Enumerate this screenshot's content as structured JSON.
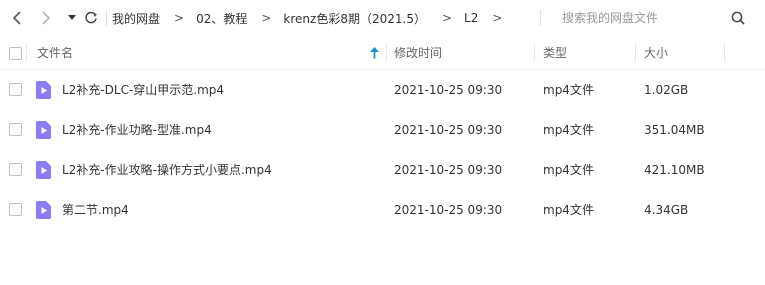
{
  "toolbar": {
    "back_icon": "back-arrow-icon",
    "forward_icon": "forward-arrow-icon",
    "history_icon": "dropdown-triangle-icon",
    "refresh_icon": "refresh-icon"
  },
  "breadcrumb": [
    {
      "label": "我的网盘"
    },
    {
      "label": "02、教程"
    },
    {
      "label": "krenz色彩8期（2021.5）"
    },
    {
      "label": "L2"
    }
  ],
  "breadcrumb_separator": ">",
  "search": {
    "placeholder": "搜索我的网盘文件",
    "value": ""
  },
  "table": {
    "headers": {
      "name": "文件名",
      "modified": "修改时间",
      "type": "类型",
      "size": "大小"
    },
    "sort": {
      "column": "name",
      "direction": "ascending"
    },
    "rows": [
      {
        "name": "L2补充-DLC-穿山甲示范.mp4",
        "modified": "2021-10-25 09:30",
        "type": "mp4文件",
        "size": "1.02GB"
      },
      {
        "name": "L2补充-作业功略-型准.mp4",
        "modified": "2021-10-25 09:30",
        "type": "mp4文件",
        "size": "351.04MB"
      },
      {
        "name": "L2补充-作业攻略-操作方式小要点.mp4",
        "modified": "2021-10-25 09:30",
        "type": "mp4文件",
        "size": "421.10MB"
      },
      {
        "name": "第二节.mp4",
        "modified": "2021-10-25 09:30",
        "type": "mp4文件",
        "size": "4.34GB"
      }
    ]
  },
  "colors": {
    "file_icon": "#8b7cf6",
    "sort_arrow": "#1f8fd6",
    "text": "#333333",
    "muted": "#666666"
  }
}
